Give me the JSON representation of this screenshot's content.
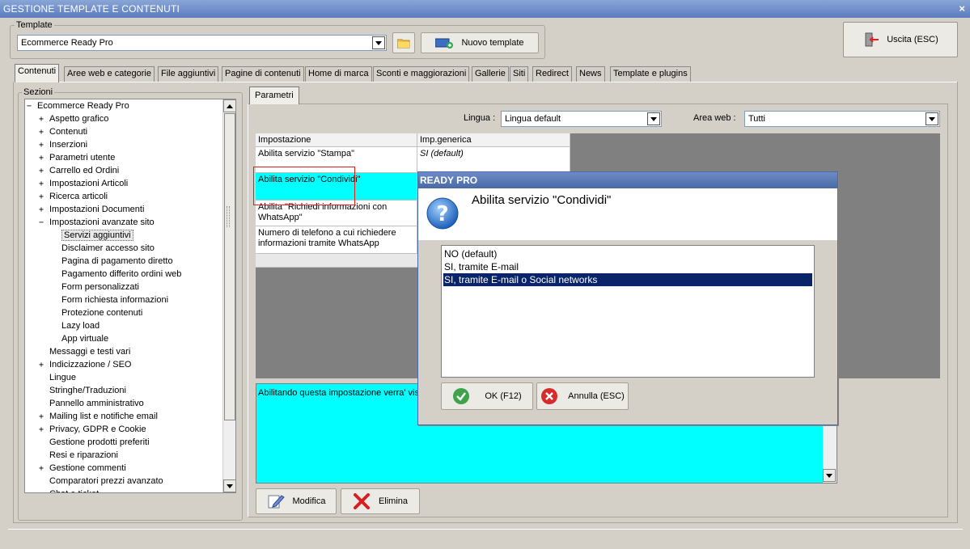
{
  "window": {
    "title": "GESTIONE TEMPLATE E CONTENUTI",
    "close_label": "×"
  },
  "template_group": {
    "label": "Template",
    "selected": "Ecommerce Ready Pro",
    "new_button": "Nuovo template"
  },
  "exit_button": "Uscita (ESC)",
  "tabs": [
    "Contenuti",
    "Aree web e categorie",
    "File aggiuntivi",
    "Pagine di contenuti",
    "Home di marca",
    "Sconti e maggiorazioni",
    "Gallerie",
    "Siti",
    "Redirect",
    "News",
    "Template e plugins"
  ],
  "sections": {
    "label": "Sezioni",
    "items": [
      {
        "label": "Ecommerce Ready Pro",
        "marker": "−",
        "level": 0
      },
      {
        "label": "Aspetto grafico",
        "marker": "+",
        "level": 1
      },
      {
        "label": "Contenuti",
        "marker": "+",
        "level": 1
      },
      {
        "label": "Inserzioni",
        "marker": "+",
        "level": 1
      },
      {
        "label": "Parametri utente",
        "marker": "+",
        "level": 1
      },
      {
        "label": "Carrello ed Ordini",
        "marker": "+",
        "level": 1
      },
      {
        "label": "Impostazioni Articoli",
        "marker": "+",
        "level": 1
      },
      {
        "label": "Ricerca articoli",
        "marker": "+",
        "level": 1
      },
      {
        "label": "Impostazioni Documenti",
        "marker": "+",
        "level": 1
      },
      {
        "label": "Impostazioni avanzate sito",
        "marker": "−",
        "level": 1
      },
      {
        "label": "Servizi aggiuntivi",
        "marker": "",
        "level": 2,
        "selected": true
      },
      {
        "label": "Disclaimer accesso sito",
        "marker": "",
        "level": 2
      },
      {
        "label": "Pagina di pagamento diretto",
        "marker": "",
        "level": 2
      },
      {
        "label": "Pagamento differito ordini web",
        "marker": "",
        "level": 2
      },
      {
        "label": "Form personalizzati",
        "marker": "",
        "level": 2
      },
      {
        "label": "Form richiesta informazioni",
        "marker": "",
        "level": 2
      },
      {
        "label": "Protezione contenuti",
        "marker": "",
        "level": 2
      },
      {
        "label": "Lazy load",
        "marker": "",
        "level": 2
      },
      {
        "label": "App virtuale",
        "marker": "",
        "level": 2
      },
      {
        "label": "Messaggi e testi vari",
        "marker": "",
        "level": 1
      },
      {
        "label": "Indicizzazione / SEO",
        "marker": "+",
        "level": 1
      },
      {
        "label": "Lingue",
        "marker": "",
        "level": 1
      },
      {
        "label": "Stringhe/Traduzioni",
        "marker": "",
        "level": 1
      },
      {
        "label": "Pannello amministrativo",
        "marker": "",
        "level": 1
      },
      {
        "label": "Mailing list e notifiche email",
        "marker": "+",
        "level": 1
      },
      {
        "label": "Privacy, GDPR e Cookie",
        "marker": "+",
        "level": 1
      },
      {
        "label": "Gestione prodotti preferiti",
        "marker": "",
        "level": 1
      },
      {
        "label": "Resi e riparazioni",
        "marker": "",
        "level": 1
      },
      {
        "label": "Gestione commenti",
        "marker": "+",
        "level": 1
      },
      {
        "label": "Comparatori prezzi avanzato",
        "marker": "",
        "level": 1
      },
      {
        "label": "Chat e ticket...",
        "marker": "",
        "level": 1
      }
    ]
  },
  "params": {
    "tab": "Parametri",
    "lingua_label": "Lingua :",
    "lingua_value": "Lingua default",
    "area_label": "Area web :",
    "area_value": "Tutti",
    "grid": {
      "headers": [
        "Impostazione",
        "Imp.generica"
      ],
      "rows": [
        {
          "name": "Abilita servizio \"Stampa\"",
          "value": "SI (default)"
        },
        {
          "name": "Abilita servizio \"Condividi\"",
          "value": ""
        },
        {
          "name": "Abilita \"Richiedi informazioni con WhatsApp\"",
          "value": ""
        },
        {
          "name": "Numero di telefono a cui richiedere informazioni tramite WhatsApp",
          "value": ""
        }
      ]
    },
    "description": "Abilitando questa impostazione verra' visu",
    "modify_button": "Modifica",
    "delete_button": "Elimina"
  },
  "dialog": {
    "title": "READY PRO",
    "heading": "Abilita servizio \"Condividi\"",
    "options": [
      "NO (default)",
      "SI, tramite E-mail",
      "SI, tramite E-mail o Social networks"
    ],
    "selected_index": 2,
    "ok_button": "OK (F12)",
    "cancel_button": "Annulla (ESC)"
  },
  "colors": {
    "highlight_cyan": "#00ffff",
    "selection_navy": "#0a246a",
    "annotation_red": "#e0201a"
  }
}
